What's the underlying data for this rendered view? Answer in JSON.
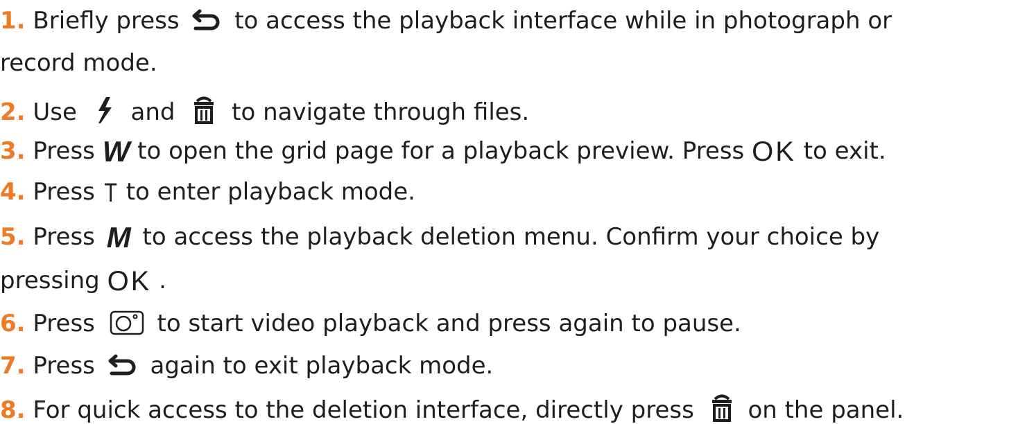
{
  "steps": [
    {
      "number": "1.",
      "text_a": "Briefly press",
      "text_b": "to access the playback interface while in photograph or",
      "text_cont": "record mode."
    },
    {
      "number": "2.",
      "text_a": "Use",
      "text_b": "and",
      "text_c": "to navigate through files."
    },
    {
      "number": "3.",
      "text_a": "Press",
      "key_w": "W",
      "text_b": "to open the grid page for a playback preview. Press",
      "key_ok": "OK",
      "text_c": "to exit."
    },
    {
      "number": "4.",
      "text_a": "Press",
      "key_t": "T",
      "text_b": "to enter playback mode."
    },
    {
      "number": "5.",
      "text_a": "Press",
      "key_m": "M",
      "text_b": "to access the playback deletion menu. Confirm your choice by",
      "text_cont": "pressing",
      "key_ok": "OK",
      "text_end": "."
    },
    {
      "number": "6.",
      "text_a": "Press",
      "text_b": "to start video playback and press again to pause."
    },
    {
      "number": "7.",
      "text_a": "Press",
      "text_b": "again to exit playback mode."
    },
    {
      "number": "8.",
      "text_a": "For quick access to the deletion interface, directly press",
      "text_b": "on the panel."
    }
  ],
  "icons": {
    "back": "back-arrow-icon",
    "flash": "flash-icon",
    "trash": "trash-icon",
    "camera": "camera-icon"
  },
  "colors": {
    "step_number": "#ee7a26",
    "text": "#1e1e1e"
  }
}
